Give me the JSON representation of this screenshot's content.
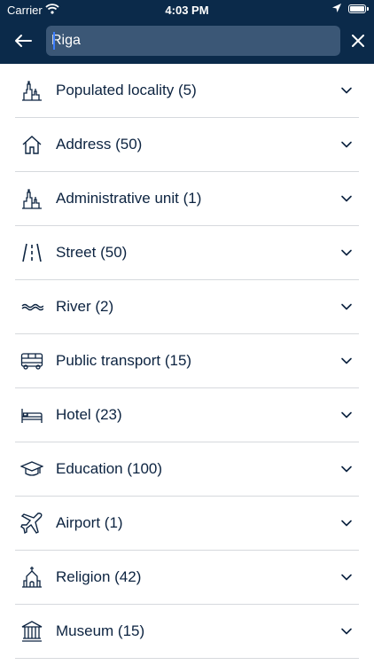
{
  "status_bar": {
    "carrier": "Carrier",
    "time": "4:03 PM"
  },
  "search": {
    "value": "Riga"
  },
  "categories": [
    {
      "label": "Populated locality (5)",
      "icon": "city-icon"
    },
    {
      "label": "Address (50)",
      "icon": "house-icon"
    },
    {
      "label": "Administrative unit (1)",
      "icon": "city-icon"
    },
    {
      "label": "Street (50)",
      "icon": "road-icon"
    },
    {
      "label": "River (2)",
      "icon": "wave-icon"
    },
    {
      "label": "Public transport (15)",
      "icon": "bus-icon"
    },
    {
      "label": "Hotel (23)",
      "icon": "bed-icon"
    },
    {
      "label": "Education (100)",
      "icon": "graduation-cap-icon"
    },
    {
      "label": "Airport (1)",
      "icon": "airplane-icon"
    },
    {
      "label": "Religion (42)",
      "icon": "church-icon"
    },
    {
      "label": "Museum (15)",
      "icon": "museum-icon"
    }
  ],
  "colors": {
    "header_bg": "#0b2a4a",
    "search_bg": "#3b5776",
    "text": "#0c2340",
    "divider": "#d6d9dd",
    "caret": "#3d7eff"
  }
}
